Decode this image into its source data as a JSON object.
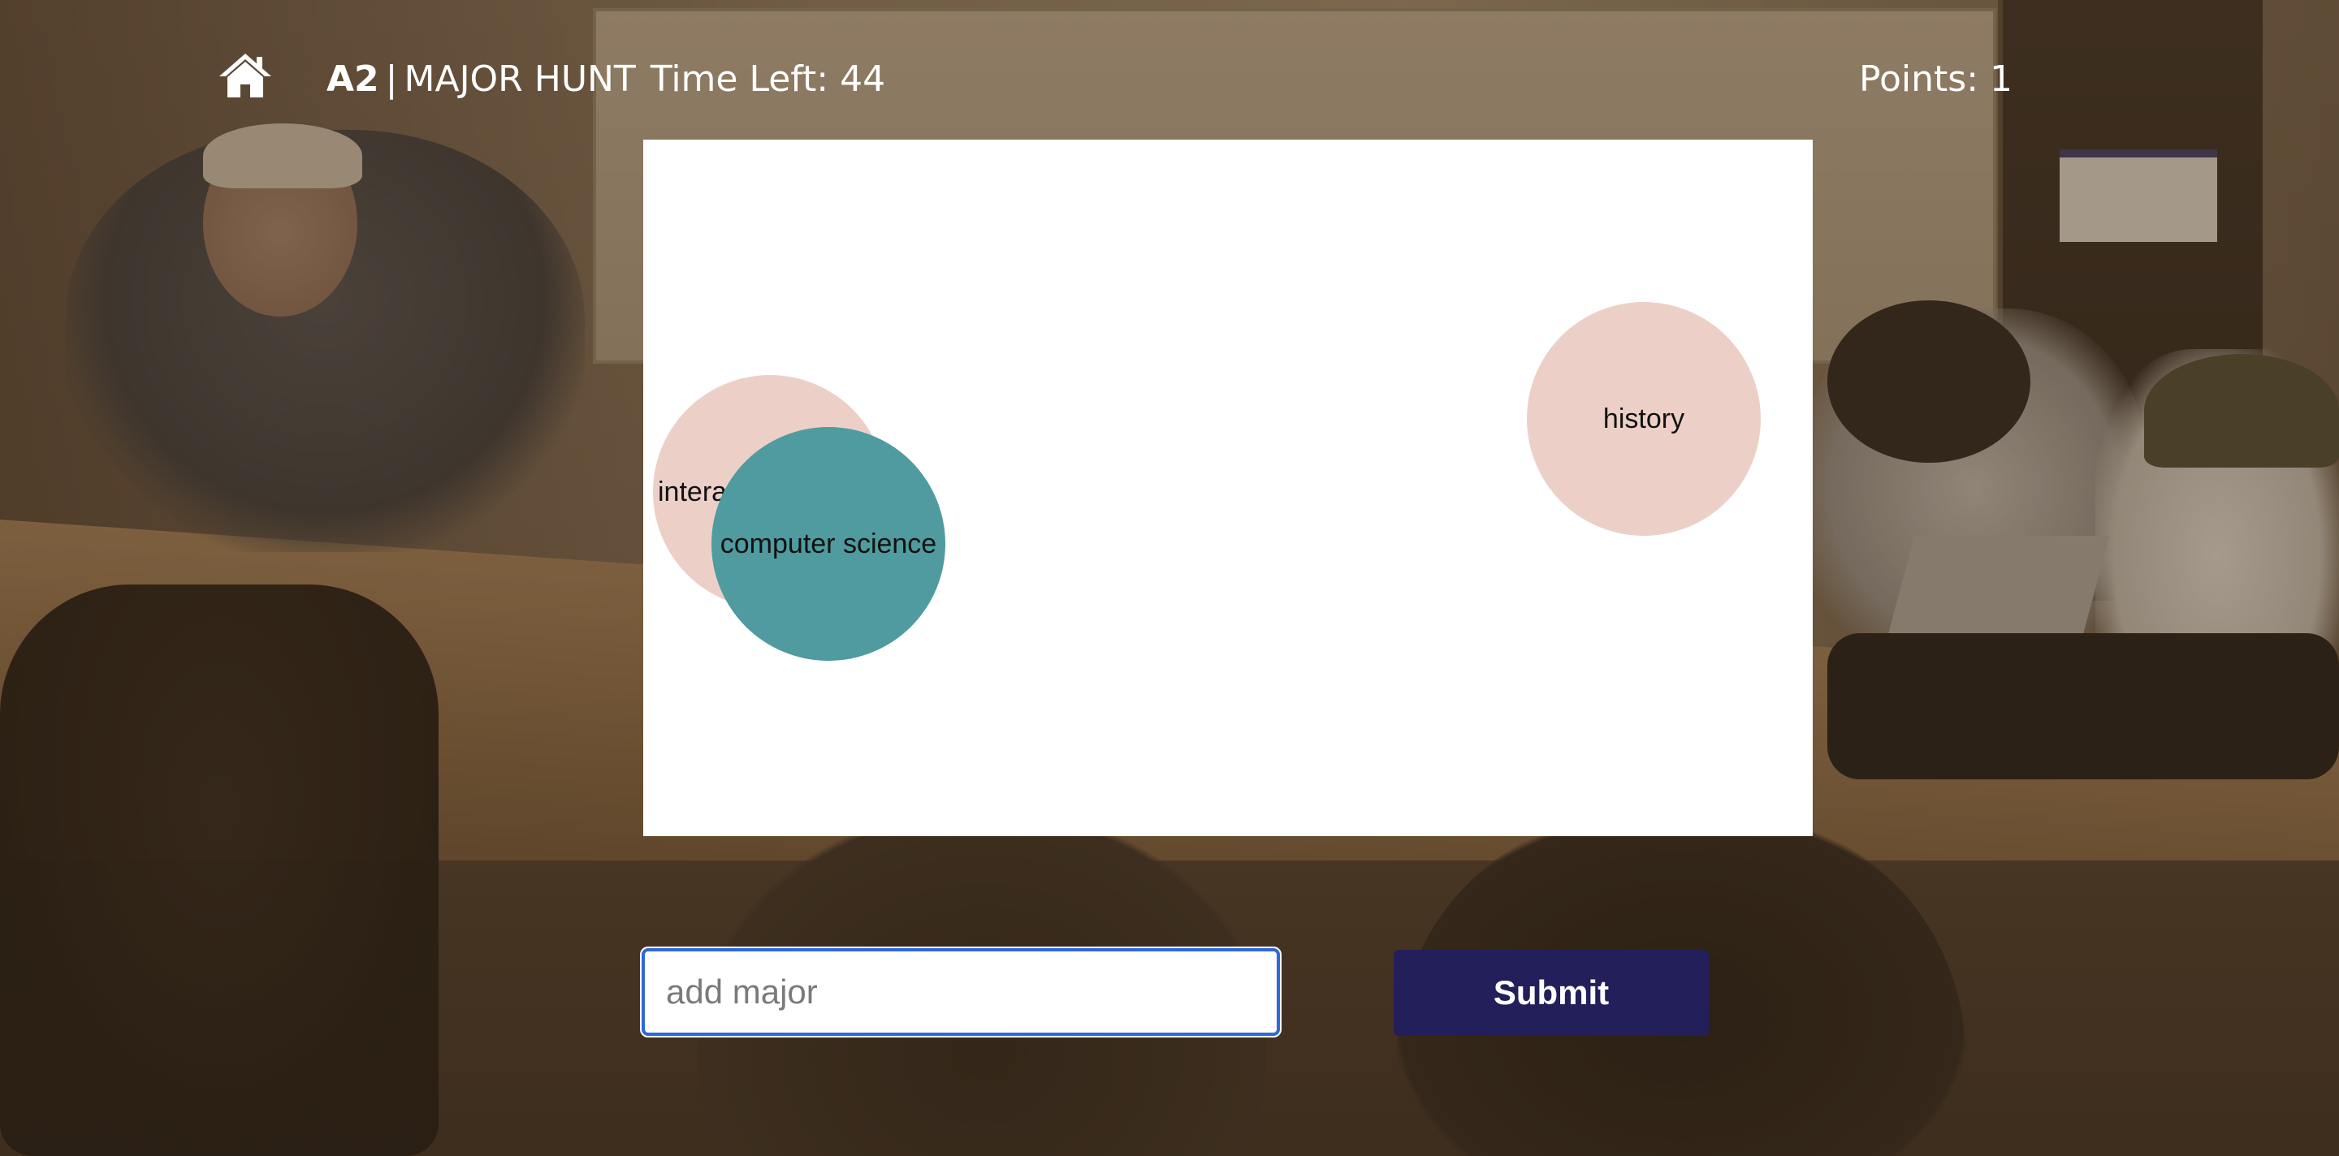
{
  "header": {
    "home_icon": "home-icon",
    "game_code": "A2",
    "separator": "|",
    "game_name": "MAJOR HUNT",
    "time_left_label": "Time Left: 44",
    "points_label": "Points: 1"
  },
  "board": {
    "bubbles": [
      {
        "label": "intera",
        "color": "#ecd0c7"
      },
      {
        "label": "computer science",
        "color": "#4f9ba0"
      },
      {
        "label": "history",
        "color": "#ecd0c7"
      }
    ]
  },
  "form": {
    "input_placeholder": "add major",
    "input_value": "",
    "submit_label": "Submit"
  },
  "colors": {
    "accent_button": "#231f5a",
    "input_focus_border": "#2f68d8",
    "bubble_pink": "#ecd0c7",
    "bubble_teal": "#4f9ba0"
  }
}
